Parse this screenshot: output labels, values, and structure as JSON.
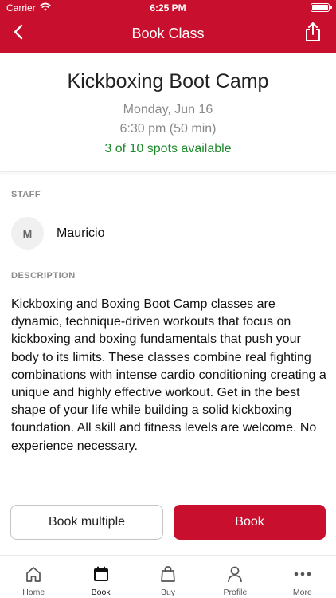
{
  "status_bar": {
    "carrier": "Carrier",
    "time": "6:25 PM"
  },
  "nav": {
    "title": "Book Class"
  },
  "class": {
    "name": "Kickboxing Boot Camp",
    "date": "Monday, Jun 16",
    "time": "6:30 pm (50 min)",
    "spots": "3 of 10 spots available"
  },
  "staff": {
    "label": "STAFF",
    "initial": "M",
    "name": "Mauricio"
  },
  "description": {
    "label": "DESCRIPTION",
    "text": "Kickboxing and Boxing Boot Camp classes are dynamic, technique-driven workouts that focus on kickboxing and boxing fundamentals that push your body to its limits. These classes combine real fighting combinations with intense cardio conditioning creating a unique and highly effective workout. Get in the best shape of your life while building a solid kickboxing foundation. All skill and fitness levels are welcome. No experience necessary."
  },
  "actions": {
    "book_multiple": "Book multiple",
    "book": "Book"
  },
  "tabs": [
    {
      "label": "Home",
      "icon": "home-icon"
    },
    {
      "label": "Book",
      "icon": "calendar-icon",
      "active": true
    },
    {
      "label": "Buy",
      "icon": "shopping-bag-icon"
    },
    {
      "label": "Profile",
      "icon": "person-icon"
    },
    {
      "label": "More",
      "icon": "more-dots-icon"
    }
  ],
  "colors": {
    "brand": "#c8102e",
    "available": "#1e8a2d",
    "muted": "#8a8a8a"
  }
}
